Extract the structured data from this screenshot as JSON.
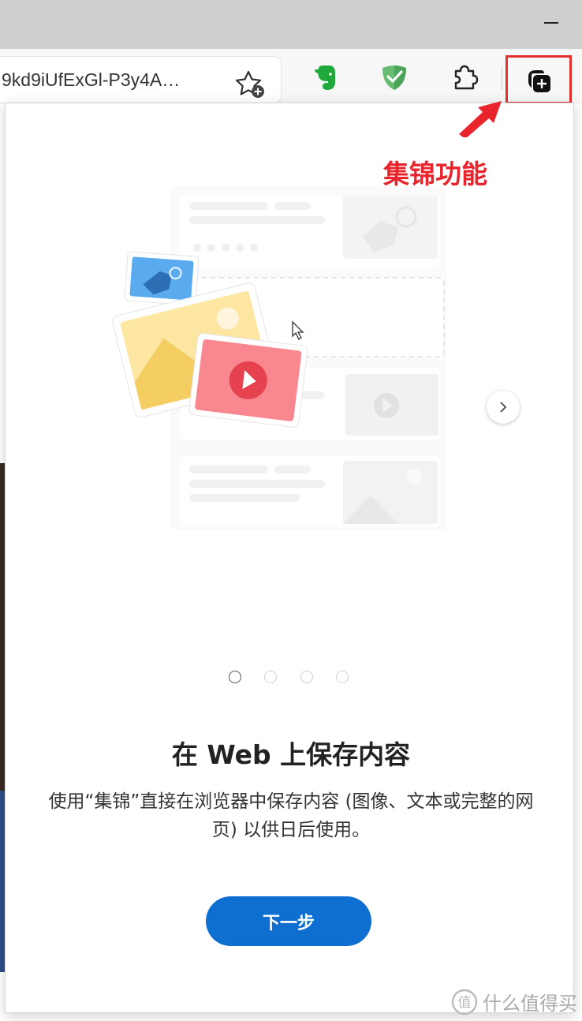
{
  "browser": {
    "address_text": "9kd9iUfExGl-P3y4A…",
    "icons": {
      "favorite": "add-favorite-icon",
      "evernote": "evernote-extension-icon",
      "shield": "adguard-shield-icon",
      "extensions": "puzzle-extensions-icon",
      "collections": "collections-icon"
    }
  },
  "annotation": {
    "label": "集锦功能",
    "color": "#e8252d"
  },
  "flyout": {
    "heading": "在 Web 上保存内容",
    "description": "使用“集锦”直接在浏览器中保存内容 (图像、文本或完整的网页) 以供日后使用。",
    "next_button": "下一步",
    "carousel_total": 4,
    "carousel_active": 1
  },
  "watermark": {
    "text": "什么值得买"
  },
  "colors": {
    "accent": "#0f6fd0",
    "annotation": "#e53030"
  }
}
